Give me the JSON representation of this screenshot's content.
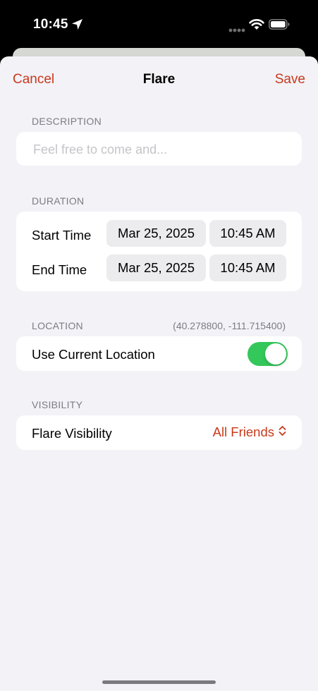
{
  "status_bar": {
    "time": "10:45"
  },
  "nav": {
    "cancel": "Cancel",
    "title": "Flare",
    "save": "Save"
  },
  "description": {
    "header": "DESCRIPTION",
    "placeholder": "Feel free to come and...",
    "value": ""
  },
  "duration": {
    "header": "DURATION",
    "start_label": "Start Time",
    "start_date": "Mar 25, 2025",
    "start_time": "10:45 AM",
    "end_label": "End Time",
    "end_date": "Mar 25, 2025",
    "end_time": "10:45 AM"
  },
  "location": {
    "header": "LOCATION",
    "coordinates": "(40.278800, -111.715400)",
    "use_current_label": "Use Current Location",
    "use_current_enabled": true
  },
  "visibility": {
    "header": "VISIBILITY",
    "label": "Flare Visibility",
    "value": "All Friends"
  },
  "colors": {
    "accent": "#c9391b",
    "toggle_on": "#34c759",
    "background": "#f2f2f7"
  },
  "icons": [
    "location-arrow-icon",
    "wifi-icon",
    "battery-icon",
    "chevron-updown-icon"
  ]
}
